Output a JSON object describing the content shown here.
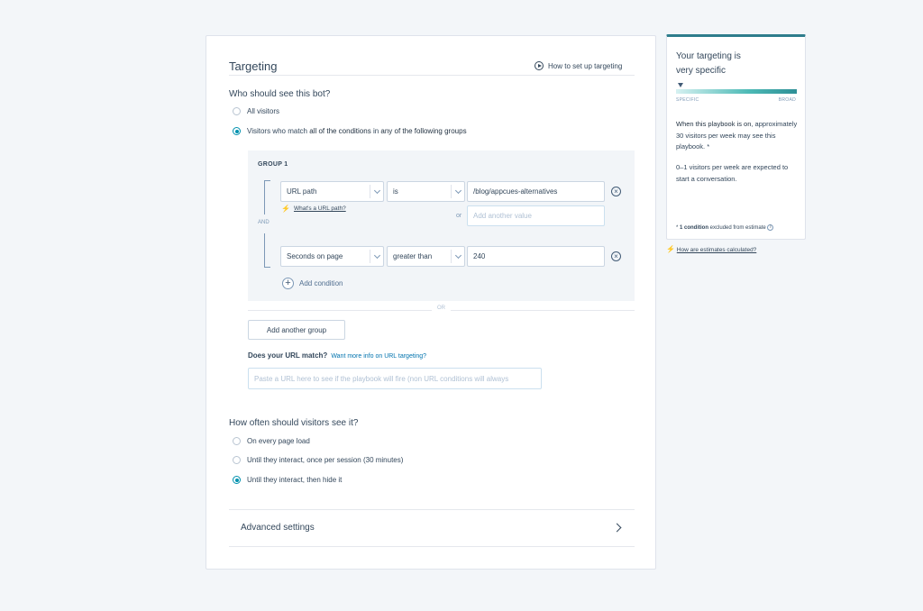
{
  "main": {
    "title": "Targeting",
    "howto_label": "How to set up targeting",
    "who_question": "Who should see this bot?",
    "who_options": [
      {
        "label": "All visitors",
        "selected": false
      },
      {
        "prefix": "Visitors who match ",
        "bold1": "all of the conditions",
        "mid": " in ",
        "bold2": "any of the following groups",
        "selected": true
      }
    ],
    "group": {
      "label": "GROUP 1",
      "and_label": "AND",
      "conditions": [
        {
          "field": "URL path",
          "operator": "is",
          "value": "/blog/appcues-alternatives",
          "help_link": "What's a URL path?",
          "or_label": "or",
          "extra_placeholder": "Add another value"
        },
        {
          "field": "Seconds on page",
          "operator": "greater than",
          "value": "240"
        }
      ],
      "add_condition": "Add condition"
    },
    "or_divider": "OR",
    "add_group_button": "Add another group",
    "url_match_label": "Does your URL match?",
    "url_match_link": "Want more info on URL targeting?",
    "url_match_placeholder": "Paste a URL here to see if the playbook will fire (non URL conditions will always",
    "frequency_question": "How often should visitors see it?",
    "frequency_options": [
      {
        "label": "On every page load",
        "selected": false
      },
      {
        "label": "Until they interact, once per session (30 minutes)",
        "selected": false
      },
      {
        "label": "Until they interact, then hide it",
        "selected": true
      }
    ],
    "advanced_label": "Advanced settings"
  },
  "side": {
    "title_line1": "Your targeting is",
    "title_line2": "very specific",
    "gauge_level": 0.02,
    "gauge_left": "SPECIFIC",
    "gauge_right": "BROAD",
    "para1_bold": "When this playbook is on",
    "para1_rest": ", approximately 30 visitors per week may see this playbook. *",
    "para2": "0–1 visitors per week are expected to start a conversation.",
    "foot_prefix": "* ",
    "foot_bold": "1 condition",
    "foot_rest": " excluded from estimate",
    "link": "How are estimates calculated?"
  },
  "colors": {
    "accent": "#0091ae",
    "gauge_top": "#2e7d8c",
    "bolt": "#e8374e",
    "link": "#0073ae"
  }
}
